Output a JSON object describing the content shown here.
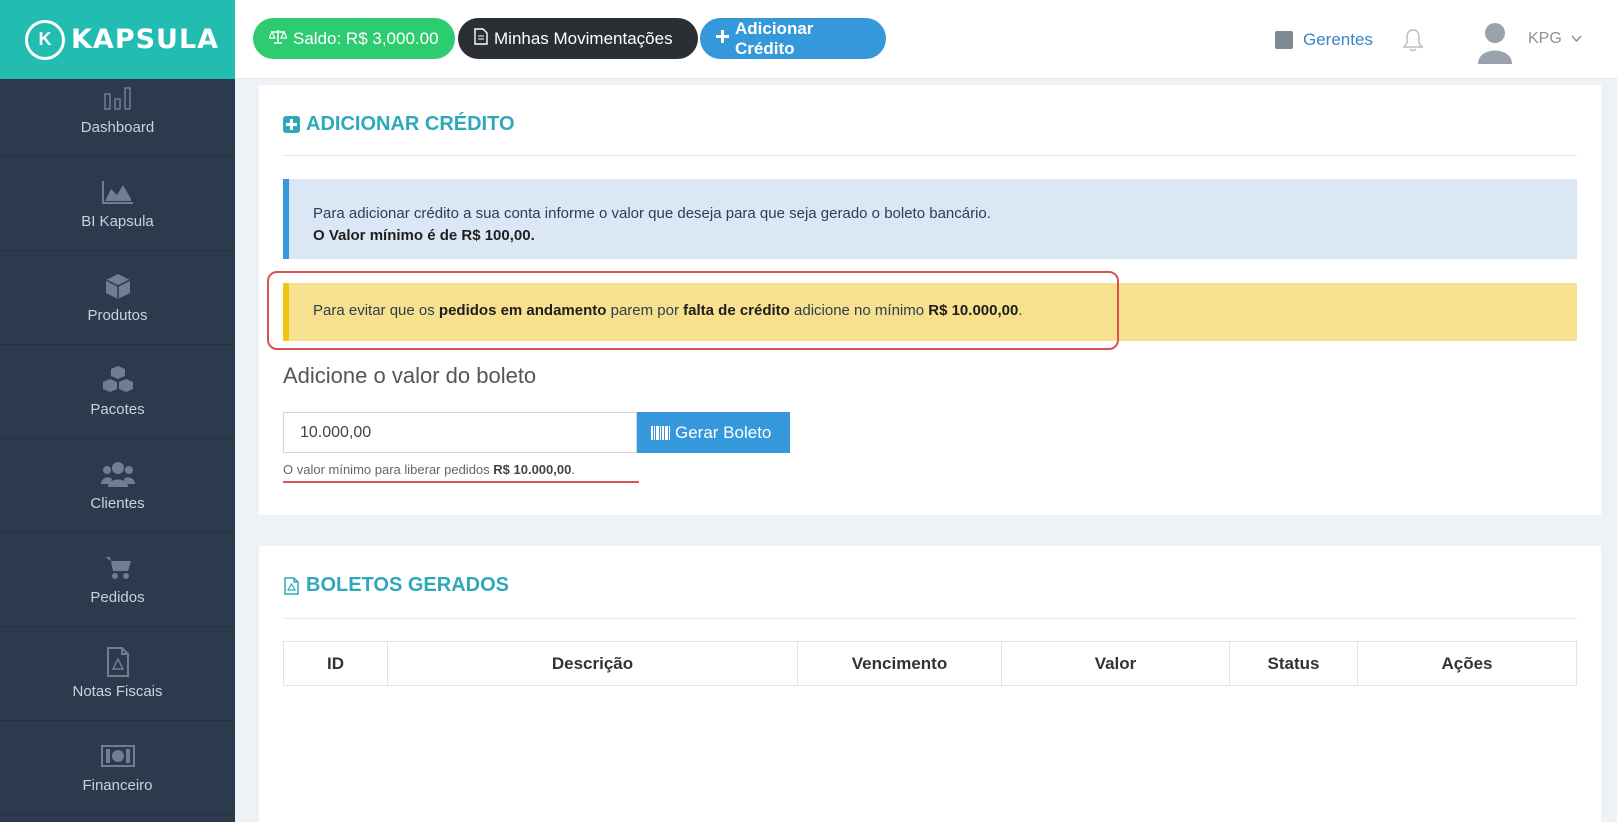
{
  "brand": {
    "logo_letter": "K",
    "name": "KAPSULA"
  },
  "sidebar": {
    "items": [
      {
        "label": "Dashboard",
        "icon": "bar-chart-icon"
      },
      {
        "label": "BI Kapsula",
        "icon": "area-chart-icon"
      },
      {
        "label": "Produtos",
        "icon": "cube-icon"
      },
      {
        "label": "Pacotes",
        "icon": "cubes-icon"
      },
      {
        "label": "Clientes",
        "icon": "users-icon"
      },
      {
        "label": "Pedidos",
        "icon": "cart-icon"
      },
      {
        "label": "Notas Fiscais",
        "icon": "file-pdf-icon"
      },
      {
        "label": "Financeiro",
        "icon": "money-icon"
      }
    ]
  },
  "topbar": {
    "saldo": "Saldo: R$ 3,000.00",
    "movimentacoes": "Minhas Movimentações",
    "adicionar": "Adicionar Crédito",
    "gerentes": "Gerentes",
    "user": "KPG"
  },
  "credit": {
    "title": "ADICIONAR CRÉDITO",
    "info_line1": "Para adicionar crédito a sua conta informe o valor que deseja para que seja gerado o boleto bancário.",
    "info_line2": "O Valor mínimo é de R$ 100,00.",
    "warn": {
      "p1": "Para evitar que os ",
      "b1": "pedidos em andamento",
      "p2": " parem por ",
      "b2": "falta de crédito",
      "p3": " adicione no mínimo ",
      "b3": "R$ 10.000,00",
      "p4": "."
    },
    "section_label": "Adicione o valor do boleto",
    "amount_value": "10.000,00",
    "button_label": "Gerar Boleto",
    "help_prefix": "O valor mínimo para liberar pedidos ",
    "help_bold": "R$ 10.000,00",
    "help_suffix": "."
  },
  "boletos": {
    "title": "BOLETOS GERADOS",
    "columns": [
      "ID",
      "Descrição",
      "Vencimento",
      "Valor",
      "Status",
      "Ações"
    ]
  },
  "colors": {
    "brand": "#22bdb0",
    "sidebar": "#2b3b4d",
    "accent_blue": "#3498db",
    "title_teal": "#2fa9b9",
    "highlight_red": "#d9534f"
  }
}
